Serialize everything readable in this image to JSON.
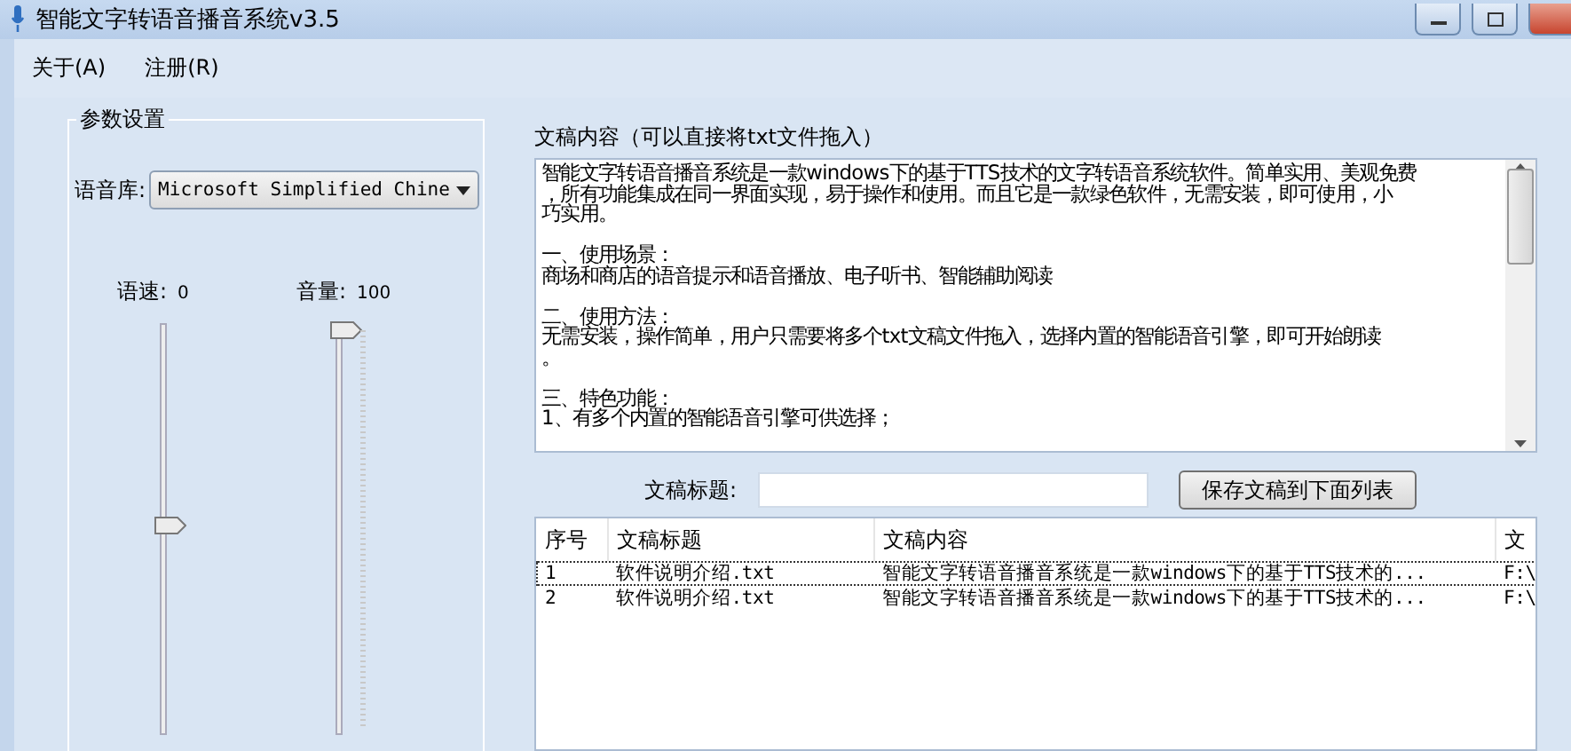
{
  "window": {
    "title": "智能文字转语音播音系统v3.5"
  },
  "menu": [
    {
      "label": "关于(A)"
    },
    {
      "label": "注册(R)"
    }
  ],
  "params": {
    "title": "参数设置",
    "voice_label": "语音库:",
    "voice_value": "Microsoft Simplified Chine",
    "sliders": [
      {
        "label": "语速:",
        "reading": "0",
        "level": 0.5,
        "ticks": false
      },
      {
        "label": "音量:",
        "reading": "100",
        "level": 1,
        "ticks": true
      }
    ]
  },
  "editor": {
    "label": "文稿内容（可以直接将txt文件拖入）",
    "paragraphs": [
      [
        "智能文字转语音播音系统是一款windows下的基于TTS技术的文字转语音系统软件。简单实用、美观免费",
        "，所有功能集成在同一界面实现，易于操作和使用。而且它是一款绿色软件，无需安装，即可使用，小",
        "巧实用。"
      ],
      [
        "一、使用场景：",
        "商场和商店的语音提示和语音播放、电子听书、智能辅助阅读"
      ],
      [
        "二、使用方法：",
        "无需安装，操作简单，用户只需要将多个txt文稿文件拖入，选择内置的智能语音引擎，即可开始朗读",
        "。"
      ],
      [
        "三、特色功能：",
        "1、有多个内置的智能语音引擎可供选择；"
      ]
    ],
    "title_label": "文稿标题:",
    "save_button": "保存文稿到下面列表"
  },
  "table": {
    "columns": [
      "序号",
      "文稿标题",
      "文稿内容",
      "文"
    ],
    "rows": [
      {
        "cells": [
          "1",
          "软件说明介绍.txt",
          "智能文字转语音播音系统是一款windows下的基于TTS技术的...",
          "F:\\"
        ],
        "focused": true
      },
      {
        "cells": [
          "2",
          "软件说明介绍.txt",
          "智能文字转语音播音系统是一款windows下的基于TTS技术的...",
          "F:\\"
        ],
        "focused": false
      }
    ]
  }
}
